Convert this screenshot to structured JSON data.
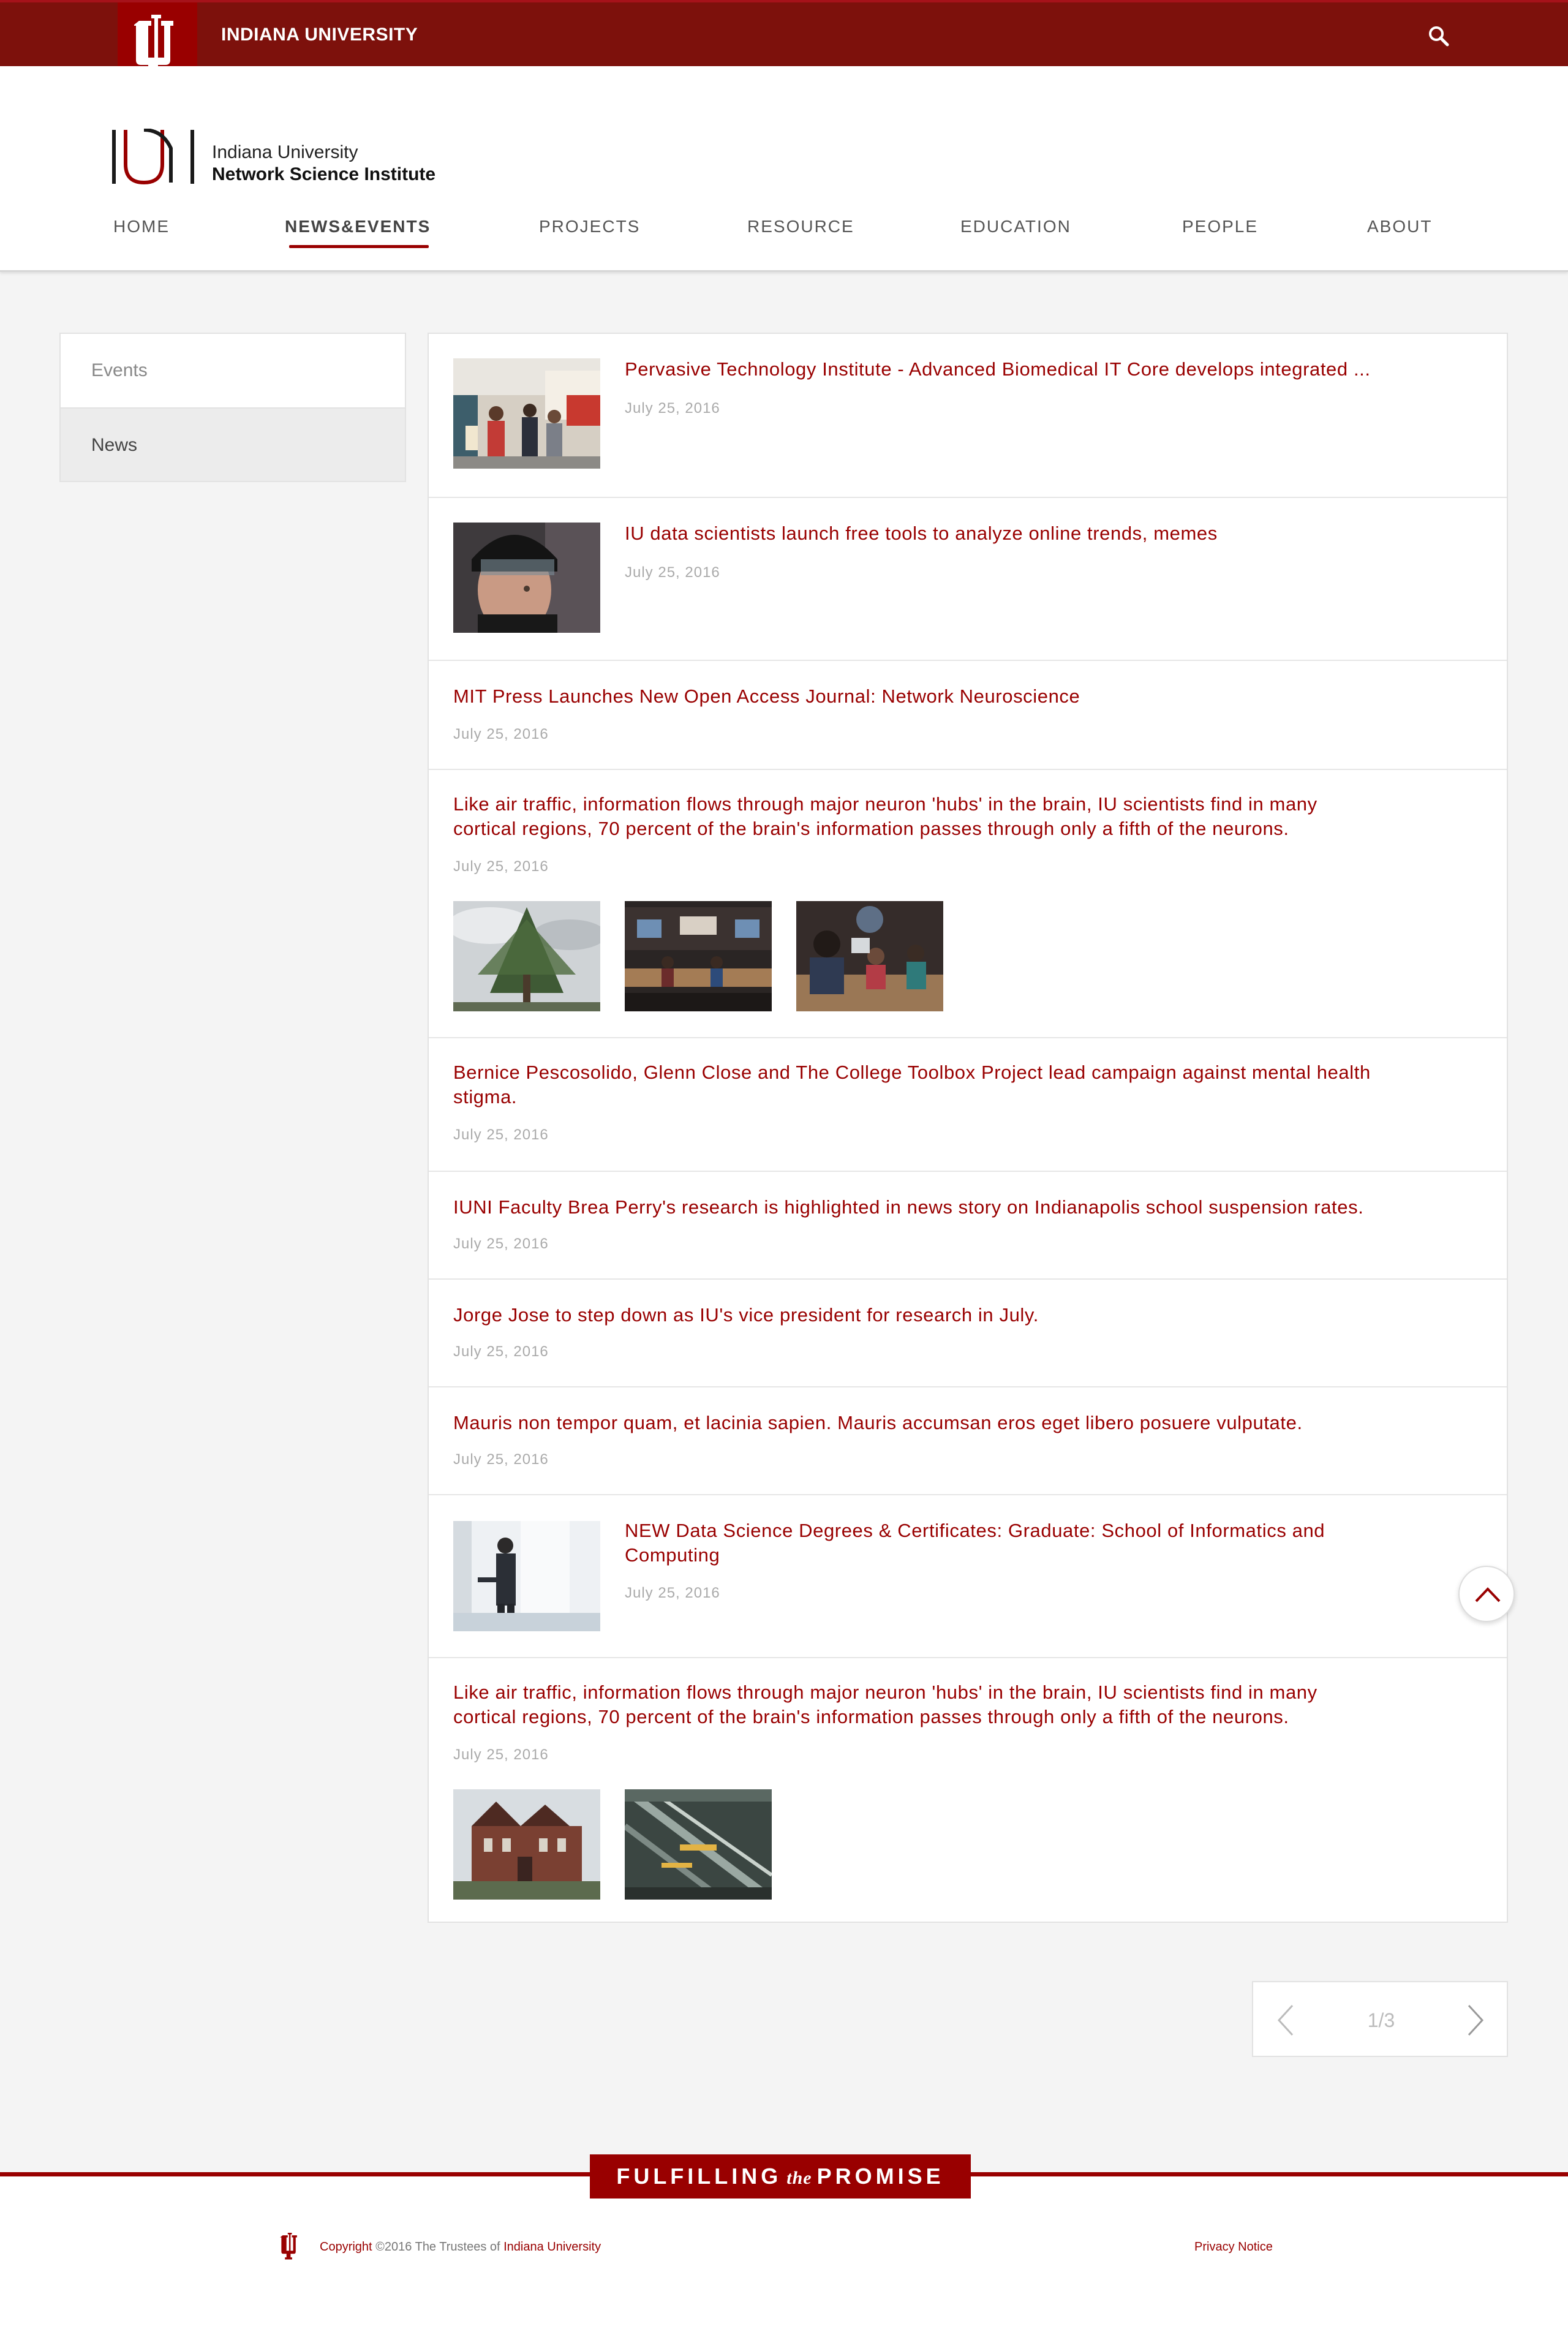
{
  "topbar": {
    "university": "INDIANA UNIVERSITY",
    "search_icon": "search-icon",
    "brand_color": "#7d110c"
  },
  "header": {
    "logo_line1": "Indiana University",
    "logo_line2": "Network Science Institute"
  },
  "nav": {
    "items": [
      "HOME",
      "NEWS&EVENTS",
      "PROJECTS",
      "RESOURCE",
      "EDUCATION",
      "PEOPLE",
      "ABOUT"
    ],
    "active": "NEWS&EVENTS"
  },
  "sidebar": {
    "items": [
      "Events",
      "News"
    ],
    "active": "News"
  },
  "news": [
    {
      "title": "Pervasive Technology Institute - Advanced Biomedical IT Core develops integrated ...",
      "date": "July 25, 2016",
      "thumb": "photo-people-exhibit"
    },
    {
      "title": "IU data scientists launch free tools to analyze online trends, memes",
      "date": "July 25, 2016",
      "thumb": "photo-hockey-player"
    },
    {
      "title": "MIT Press Launches New Open Access Journal: Network Neuroscience",
      "date": "July 25, 2016"
    },
    {
      "title_line1": "Like air traffic, information flows through major neuron 'hubs' in the brain, IU scientists find in many",
      "title_line2": "cortical regions, 70 percent of the brain's information passes through only a fifth of the neurons.",
      "date": "July 25, 2016",
      "gallery": [
        "photo-tree",
        "photo-lab",
        "photo-students"
      ]
    },
    {
      "title_line1": "Bernice Pescosolido, Glenn Close and The College Toolbox Project lead campaign against mental health",
      "title_line2": "stigma.",
      "date": "July 25, 2016"
    },
    {
      "title": "IUNI Faculty Brea Perry's research is highlighted in news story on Indianapolis school suspension rates.",
      "date": "July 25, 2016"
    },
    {
      "title": "Jorge Jose to step down as IU's vice president for research in July.",
      "date": "July 25, 2016"
    },
    {
      "title": "Mauris non tempor quam, et lacinia sapien. Mauris accumsan eros eget libero posuere vulputate.",
      "date": "July 25, 2016"
    },
    {
      "title_line1": "NEW Data Science Degrees & Certificates: Graduate: School of Informatics and",
      "title_line2": "Computing",
      "date": "July 25, 2016",
      "thumb": "photo-businessman"
    },
    {
      "title_line1": "Like air traffic, information flows through major neuron 'hubs' in the brain, IU scientists find in many",
      "title_line2": "cortical regions, 70 percent of the brain's information passes through only a fifth of the neurons.",
      "date": "July 25, 2016",
      "gallery": [
        "photo-building",
        "photo-atrium"
      ]
    }
  ],
  "pager": {
    "label": "1/3",
    "prev_icon": "chevron-left-icon",
    "next_icon": "chevron-right-icon"
  },
  "back_to_top_icon": "chevron-up-icon",
  "footer": {
    "banner_left": "FULFILLING",
    "banner_the": "the",
    "banner_right": "PROMISE",
    "copyright_prefix": "Copyright",
    "copyright_mid": "©2016 The Trustees of",
    "copyright_link": "Indiana University",
    "privacy": "Privacy Notice"
  }
}
